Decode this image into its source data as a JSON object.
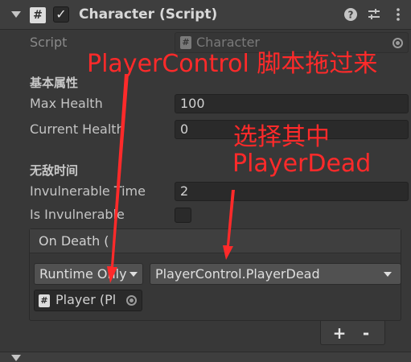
{
  "component": {
    "title": "Character (Script)",
    "icon": "#",
    "enabled_mark": "✓",
    "header_icons": [
      "help-icon",
      "preset-icon",
      "more-icon"
    ]
  },
  "script_row": {
    "label": "Script",
    "value": "Character",
    "icon": "#"
  },
  "sections": [
    {
      "title": "基本属性",
      "fields": [
        {
          "label": "Max Health",
          "value": "100"
        },
        {
          "label": "Current Health",
          "value": "0"
        }
      ]
    },
    {
      "title": "无敌时间",
      "fields": [
        {
          "label": "Invulnerable Time",
          "value": "2"
        },
        {
          "label": "Is Invulnerable",
          "value": ""
        }
      ]
    }
  ],
  "event": {
    "title": "On Death (",
    "runtime_option": "Runtime Only",
    "function": "PlayerControl.PlayerDead",
    "object": "Player (Pl",
    "object_icon": "#",
    "add_label": "+",
    "remove_label": "-"
  },
  "annotations": {
    "line1": "PlayerControl 脚本拖过来",
    "line2": "选择其中",
    "line3": "PlayerDead",
    "color": "#ff2a2a"
  },
  "colors": {
    "background": "#383838",
    "field": "#2a2a2a",
    "dropdown": "#515151",
    "text": "#c4c4c4"
  }
}
